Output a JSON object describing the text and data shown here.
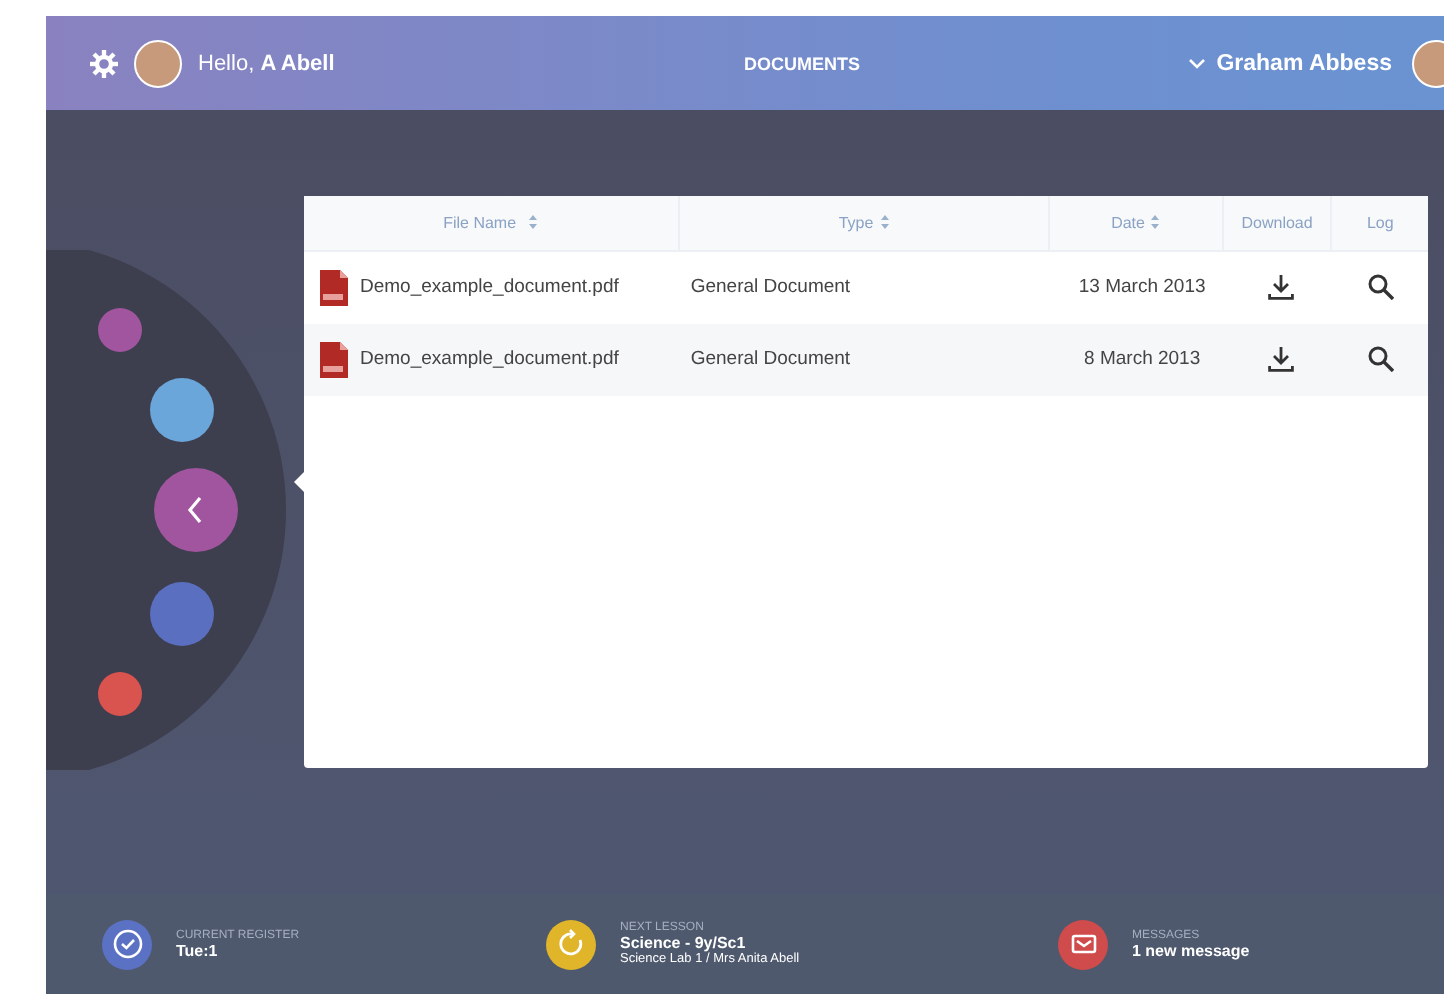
{
  "header": {
    "greeting": "Hello, **A Abell**",
    "title": "DOCUMENTS",
    "user": "Graham Abbess"
  },
  "orbit_menu": {
    "items": [
      {
        "color": "#a0559e"
      },
      {
        "color": "#6aa6da"
      },
      {
        "color": "#a0559e",
        "kind": "back"
      },
      {
        "color": "#5a6fc0"
      },
      {
        "color": "#d9534f"
      }
    ]
  },
  "table": {
    "columns": [
      {
        "label": "File Name",
        "sortable": true
      },
      {
        "label": "Type",
        "sortable": true
      },
      {
        "label": "Date",
        "sortable": true
      },
      {
        "label": "Download",
        "sortable": false
      },
      {
        "label": "Log",
        "sortable": false
      }
    ],
    "rows": [
      {
        "file": "Demo_example_document.pdf",
        "type": "General Document",
        "date": "13 March 2013"
      },
      {
        "file": "Demo_example_document.pdf",
        "type": "General Document",
        "date": "8 March 2013"
      }
    ]
  },
  "footer": [
    {
      "kind": "register",
      "label": "CURRENT REGISTER",
      "value": "Tue:1"
    },
    {
      "kind": "lesson",
      "label": "NEXT LESSON",
      "value": "Science - 9y/Sc1",
      "detail": "Science Lab 1 / Mrs Anita Abell"
    },
    {
      "kind": "messages",
      "label": "MESSAGES",
      "value": "1 new message"
    }
  ]
}
